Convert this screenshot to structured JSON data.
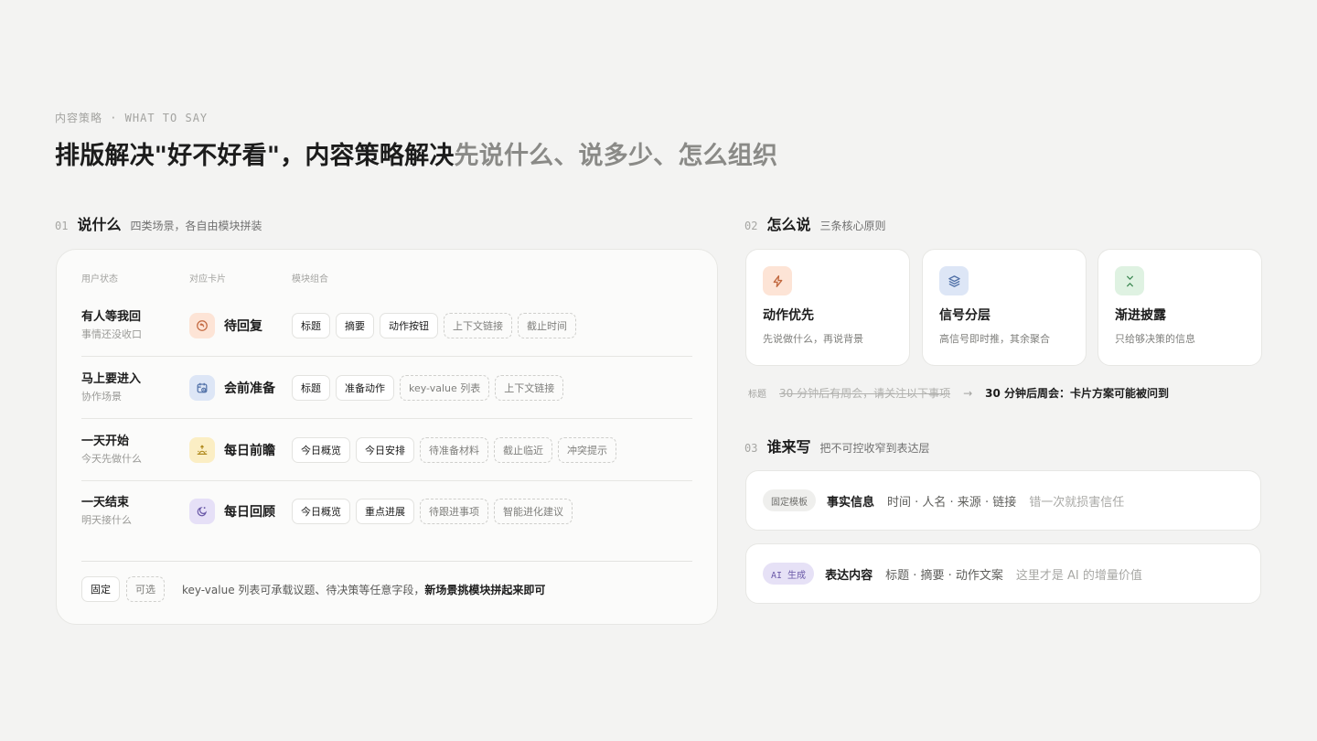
{
  "eyebrow": "内容策略 · WHAT TO SAY",
  "headline": {
    "main": "排版解决\"好不好看\"，内容策略解决",
    "dim": "先说什么、说多少、怎么组织"
  },
  "sections": {
    "s1": {
      "num": "01",
      "title": "说什么",
      "sub": "四类场景，各自由模块拼装"
    },
    "s2": {
      "num": "02",
      "title": "怎么说",
      "sub": "三条核心原则"
    },
    "s3": {
      "num": "03",
      "title": "谁来写",
      "sub": "把不可控收窄到表达层"
    }
  },
  "table": {
    "headers": {
      "state": "用户状态",
      "card": "对应卡片",
      "modules": "模块组合"
    },
    "rows": [
      {
        "state": "有人等我回",
        "sub": "事情还没收口",
        "card": "待回复",
        "fixed": [
          "标题",
          "摘要",
          "动作按钮"
        ],
        "optional": [
          "上下文链接",
          "截止时间"
        ]
      },
      {
        "state": "马上要进入",
        "sub": "协作场景",
        "card": "会前准备",
        "fixed": [
          "标题",
          "准备动作"
        ],
        "optional": [
          "key-value 列表",
          "上下文链接"
        ]
      },
      {
        "state": "一天开始",
        "sub": "今天先做什么",
        "card": "每日前瞻",
        "fixed": [
          "今日概览",
          "今日安排"
        ],
        "optional": [
          "待准备材料",
          "截止临近",
          "冲突提示"
        ]
      },
      {
        "state": "一天结束",
        "sub": "明天接什么",
        "card": "每日回顾",
        "fixed": [
          "今日概览",
          "重点进展"
        ],
        "optional": [
          "待跟进事项",
          "智能进化建议"
        ]
      }
    ],
    "legend": {
      "fixed": "固定",
      "optional": "可选"
    },
    "note": "key-value 列表可承载议题、待决策等任意字段，",
    "note_bold": "新场景挑模块拼起来即可"
  },
  "principles": [
    {
      "title": "动作优先",
      "sub": "先说做什么，再说背景",
      "icon": "bolt-icon"
    },
    {
      "title": "信号分层",
      "sub": "高信号即时推，其余聚合",
      "icon": "layers-icon"
    },
    {
      "title": "渐进披露",
      "sub": "只给够决策的信息",
      "icon": "collapse-icon"
    }
  ],
  "example": {
    "label": "标题",
    "old": "30 分钟后有周会，请关注以下事项",
    "arrow": "→",
    "new": "30 分钟后周会：卡片方案可能被问到"
  },
  "writers": [
    {
      "badge": "固定模板",
      "title": "事实信息",
      "items": "时间 · 人名 · 来源 · 链接",
      "note": "错一次就损害信任"
    },
    {
      "badge": "AI 生成",
      "title": "表达内容",
      "items": "标题 · 摘要 · 动作文案",
      "note": "这里才是 AI 的增量价值"
    }
  ],
  "colors": {
    "reply": "#fde4d6",
    "meeting": "#dde6f6",
    "morning": "#fbeec4",
    "evening": "#e6e0f7",
    "bolt": "#fde4d6",
    "layers": "#dde6f6",
    "collapse": "#dff2e2"
  }
}
